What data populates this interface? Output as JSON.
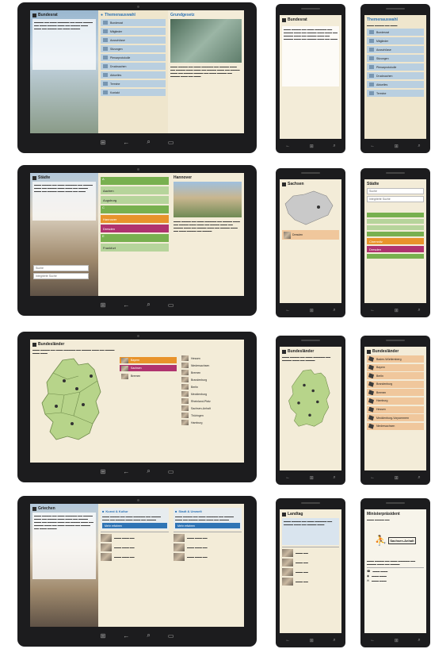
{
  "tablet1": {
    "left_title": "Bundesrat",
    "mid_title": "Themenauswahl",
    "right_title": "Grundgesetz",
    "menu": [
      "Bundesrat",
      "Mitglieder",
      "Ausschüsse",
      "Sitzungen",
      "Plenarprotokolle",
      "Drucksachen",
      "Aktuelles",
      "Termine",
      "Kontakt"
    ]
  },
  "tablet2": {
    "left_title": "Städte",
    "search_placeholder": "Suche",
    "select_value": "Integrierte Suche",
    "letters": [
      "A",
      "B",
      "C",
      "D",
      "E"
    ],
    "cities": [
      "Aachen",
      "Augsburg",
      "Hannover",
      "Dresden",
      "Frankfurt"
    ],
    "right_title": "Hannover"
  },
  "tablet3": {
    "title": "Bundesländer",
    "states_left": [
      "Bayern",
      "Sachsen",
      "Bremen"
    ],
    "states_right": [
      "Hessen",
      "Niedersachsen",
      "Bremen",
      "Brandenburg",
      "Berlin",
      "Mecklenburg",
      "Rheinland-Pfalz",
      "Sachsen-Anhalt",
      "Thüringen",
      "Hamburg"
    ]
  },
  "tablet4": {
    "left_title": "Griechen",
    "card1_title": "Kunst & Kultur",
    "card2_title": "Stadt & Umwelt",
    "btn1": "Mehr erfahren",
    "btn2": "Mehr erfahren"
  },
  "phone_r1a": {
    "title": "Bundesrat"
  },
  "phone_r1b": {
    "title": "Themenauswahl",
    "items": [
      "Bundesrat",
      "Mitglieder",
      "Ausschüsse",
      "Sitzungen",
      "Plenarprotokolle",
      "Drucksachen",
      "Aktuelles",
      "Termine"
    ]
  },
  "phone_r2a": {
    "title": "Sachsen",
    "badge": "Dresden"
  },
  "phone_r2b": {
    "title": "Städte",
    "search": "Suche",
    "select": "Integrierte Suche",
    "orange_item": "Chemnitz",
    "magenta_item": "Dresden"
  },
  "phone_r3a": {
    "title": "Bundesländer"
  },
  "phone_r3b": {
    "title": "Bundesländer",
    "items": [
      "Baden-Württemberg",
      "Bayern",
      "Berlin",
      "Brandenburg",
      "Bremen",
      "Hamburg",
      "Hessen",
      "Mecklenburg-Vorpommern",
      "Niedersachsen"
    ]
  },
  "phone_r4a": {
    "title": "Landtag"
  },
  "phone_r4b": {
    "title": "Ministerpräsident",
    "logo_text": "Sachsen-Anhalt"
  },
  "nav": {
    "back": "←",
    "home": "⌂",
    "search": "⌕"
  }
}
